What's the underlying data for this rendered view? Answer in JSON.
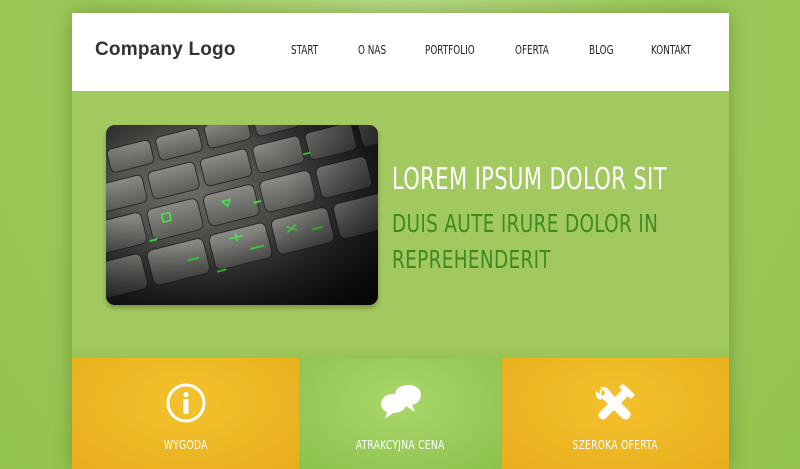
{
  "header": {
    "logo": "Company Logo",
    "nav": [
      {
        "label": "START"
      },
      {
        "label": "O NAS"
      },
      {
        "label": "PORTFOLIO"
      },
      {
        "label": "OFERTA"
      },
      {
        "label": "BLOG"
      },
      {
        "label": "KONTAKT"
      }
    ]
  },
  "hero": {
    "title": "LOREM IPSUM DOLOR SIT",
    "subtitle": "DUIS AUTE IRURE DOLOR IN REPREHENDERIT",
    "image_icon": "keyboard-photo"
  },
  "features": [
    {
      "label": "WYGODA",
      "icon": "info-icon"
    },
    {
      "label": "ATRAKCYJNA CENA",
      "icon": "chat-bubbles-icon"
    },
    {
      "label": "SZEROKA OFERTA",
      "icon": "tools-icon"
    }
  ],
  "colors": {
    "background": "#9fcb5c",
    "hero": "#a2c95f",
    "accent_green": "#3f8a22",
    "yellow": "#f0b826",
    "key_glow": "#3ddc3a"
  }
}
